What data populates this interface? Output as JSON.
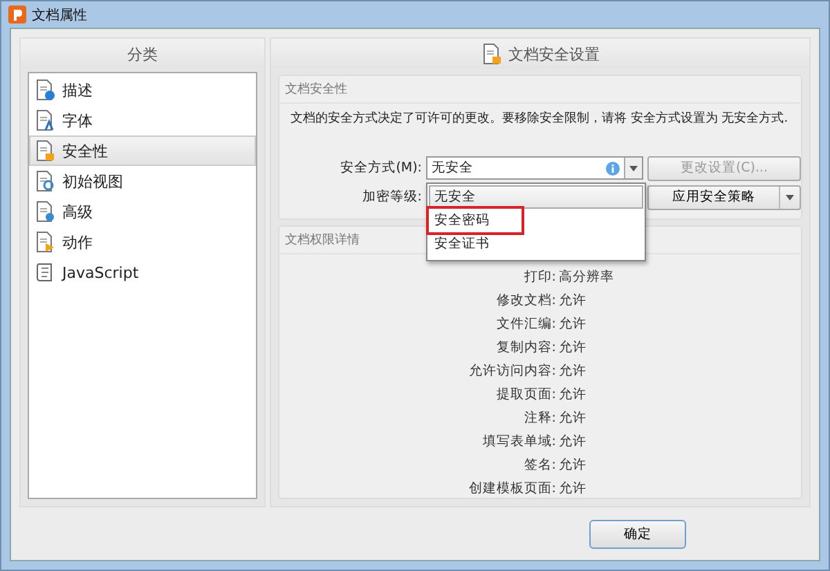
{
  "window": {
    "title": "文档属性"
  },
  "sidebar": {
    "header": "分类",
    "items": [
      {
        "label": "描述",
        "selected": false
      },
      {
        "label": "字体",
        "selected": false
      },
      {
        "label": "安全性",
        "selected": true
      },
      {
        "label": "初始视图",
        "selected": false
      },
      {
        "label": "高级",
        "selected": false
      },
      {
        "label": "动作",
        "selected": false
      },
      {
        "label": "JavaScript",
        "selected": false
      }
    ]
  },
  "panel": {
    "header": "文档安全设置",
    "security_group": {
      "title": "文档安全性",
      "description": "文档的安全方式决定了可许可的更改。要移除安全限制，请将 安全方式设置为 无安全方式.",
      "method_label": "安全方式(M):",
      "method_value": "无安全",
      "change_settings": {
        "label": "更改设置(C)...",
        "disabled": true
      },
      "encryption_label": "加密等级:",
      "apply_policy": "应用安全策略",
      "dropdown_items": [
        {
          "label": "无安全",
          "hovered": true,
          "highlighted": false
        },
        {
          "label": "安全密码",
          "hovered": false,
          "highlighted": true
        },
        {
          "label": "安全证书",
          "hovered": false,
          "highlighted": false
        }
      ]
    },
    "permissions_group": {
      "title": "文档权限详情",
      "rows": [
        {
          "label": "打印:",
          "value": "高分辨率"
        },
        {
          "label": "修改文档:",
          "value": "允许"
        },
        {
          "label": "文件汇编:",
          "value": "允许"
        },
        {
          "label": "复制内容:",
          "value": "允许"
        },
        {
          "label": "允许访问内容:",
          "value": "允许"
        },
        {
          "label": "提取页面:",
          "value": "允许"
        },
        {
          "label": "注释:",
          "value": "允许"
        },
        {
          "label": "填写表单域:",
          "value": "允许"
        },
        {
          "label": "签名:",
          "value": "允许"
        },
        {
          "label": "创建模板页面:",
          "value": "允许"
        }
      ]
    }
  },
  "buttons": [
    {
      "label": "确定"
    }
  ]
}
